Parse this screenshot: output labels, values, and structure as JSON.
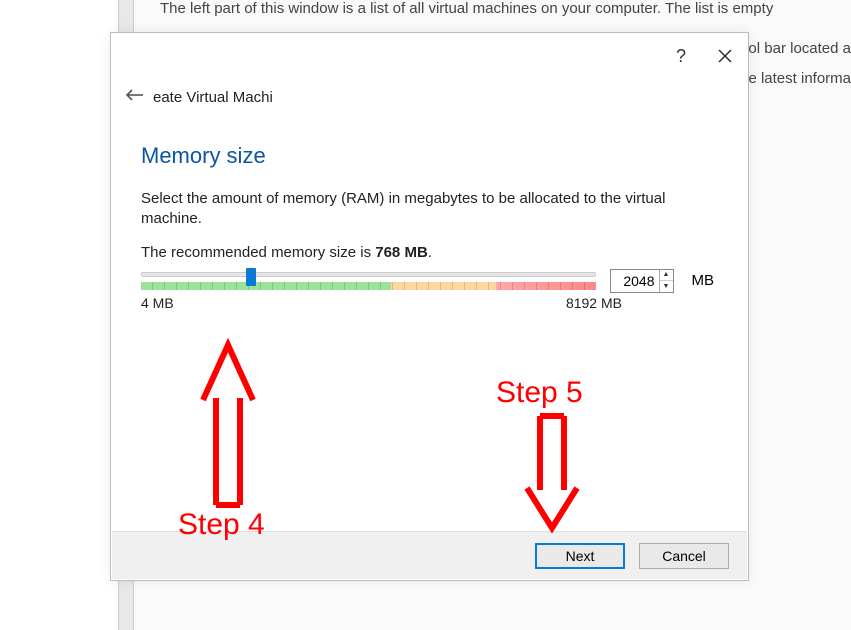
{
  "background": {
    "line1": "The left part of this window is a list of all virtual machines on your computer. The list is empty",
    "line2": "ol bar located a",
    "line3": "e latest informa"
  },
  "dialog": {
    "breadcrumb": "eate Virtual Machi",
    "heading": "Memory size",
    "description": "Select the amount of memory (RAM) in megabytes to be allocated to the virtual machine.",
    "recommend_prefix": "The recommended memory size is ",
    "recommend_value": "768 MB",
    "recommend_suffix": ".",
    "min_label": "4 MB",
    "max_label": "8192 MB",
    "value": "2048",
    "unit": "MB",
    "next_label": "Next",
    "cancel_label": "Cancel"
  },
  "annotations": {
    "step4": "Step 4",
    "step5": "Step 5"
  }
}
